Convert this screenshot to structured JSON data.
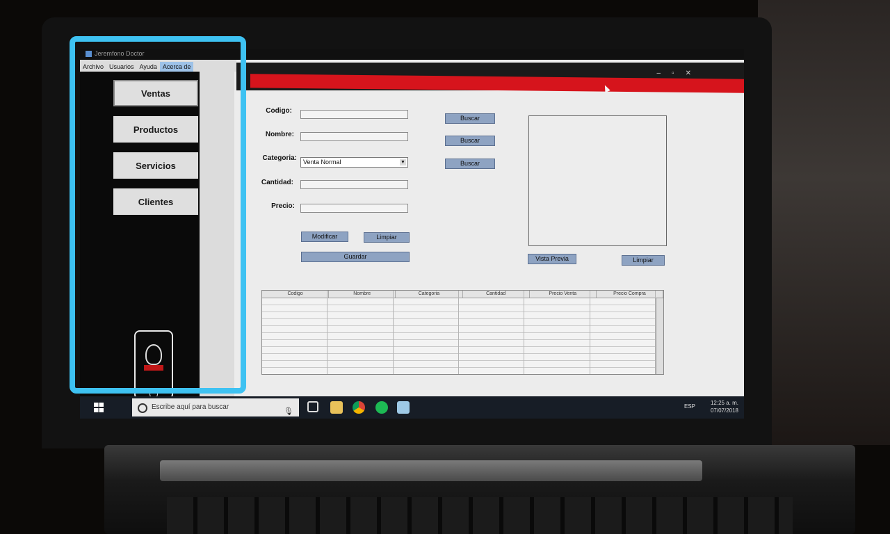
{
  "app": {
    "title": "Jeremfono Doctor"
  },
  "menu": [
    "Archivo",
    "Usuarios",
    "Ayuda",
    "Acerca de"
  ],
  "sidebar": [
    {
      "label": "Ventas"
    },
    {
      "label": "Productos"
    },
    {
      "label": "Servicios"
    },
    {
      "label": "Clientes"
    }
  ],
  "form": {
    "codigo_label": "Codigo:",
    "codigo_value": "",
    "nombre_label": "Nombre:",
    "nombre_value": "",
    "categoria_label": "Categoria:",
    "categoria_value": "Venta Normal",
    "cantidad_label": "Cantidad:",
    "cantidad_value": "",
    "precio_label": "Precio:",
    "precio_value": "",
    "buscar_1": "Buscar",
    "buscar_2": "Buscar",
    "buscar_3": "Buscar",
    "modificar": "Modificar",
    "limpiar": "Limpiar",
    "guardar": "Guardar"
  },
  "preview": {
    "vista_previa": "Vista Previa",
    "limpiar": "Limpiar"
  },
  "table": {
    "columns": [
      "Codigo",
      "Nombre",
      "Categoria",
      "Cantidad",
      "Precio Venta",
      "Precio Compra"
    ]
  },
  "taskbar": {
    "search_placeholder": "Escribe aquí para buscar",
    "lang": "ESP",
    "time": "12:25 a. m.",
    "date": "07/07/2018"
  },
  "colors": {
    "highlight": "#3ec2f2",
    "accent_red": "#d6141c",
    "button_blue": "#8ea3c2"
  },
  "icons": [
    "windows-start-icon",
    "search-icon",
    "microphone-icon",
    "task-view-icon",
    "file-explorer-icon",
    "chrome-icon",
    "spotify-icon",
    "app-icon",
    "notification-icon"
  ]
}
